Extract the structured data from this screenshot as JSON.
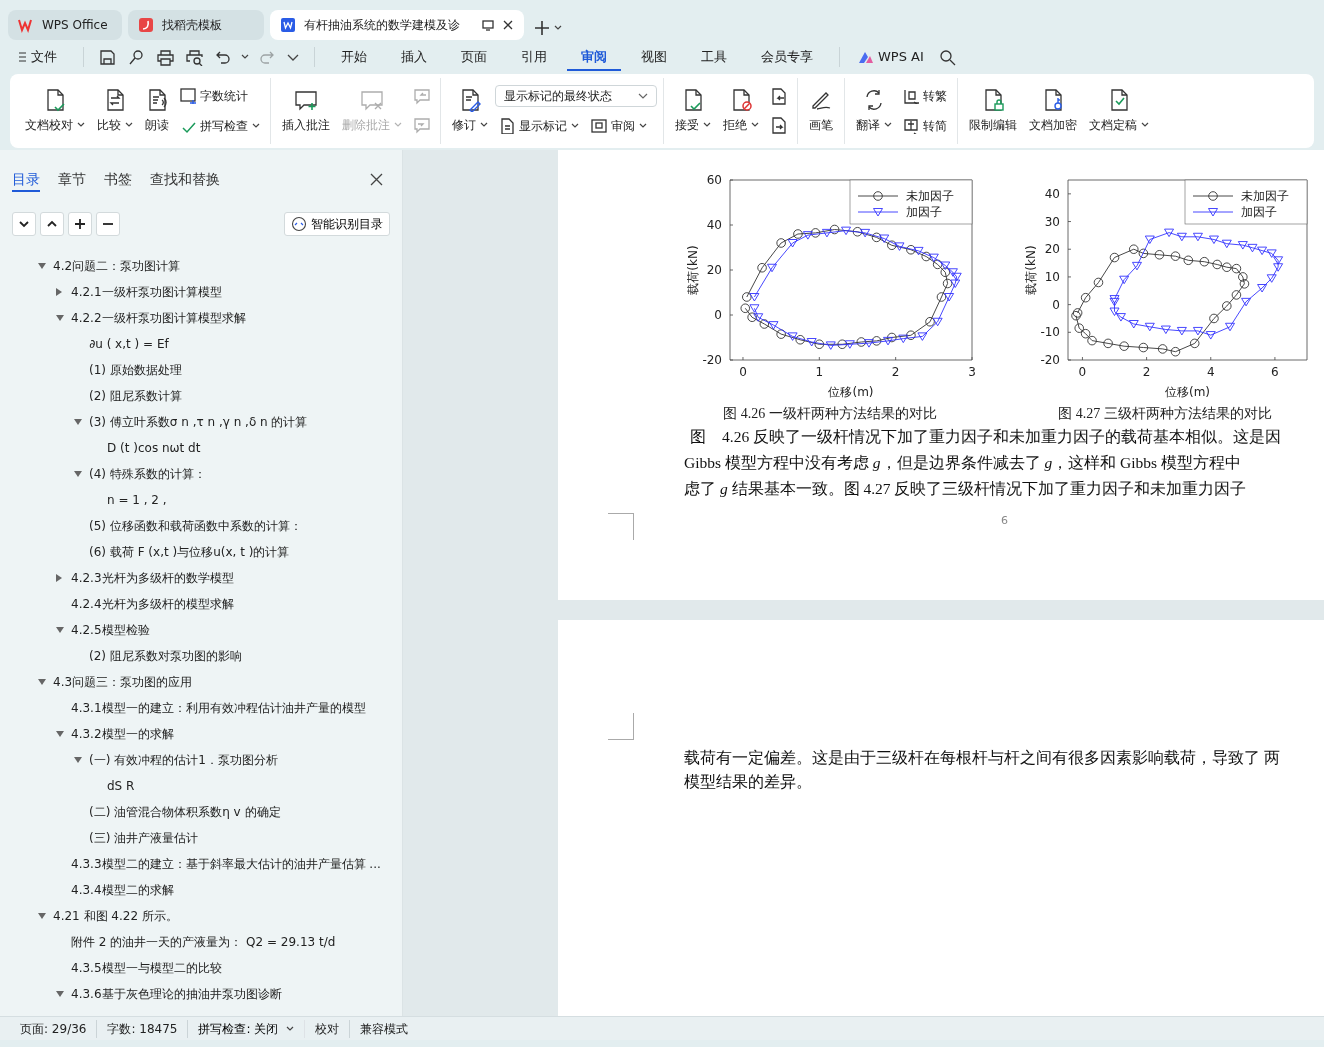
{
  "window_tabs": [
    {
      "label": "WPS Office",
      "selected": false
    },
    {
      "label": "找稻壳模板",
      "selected": false
    },
    {
      "label": "有杆抽油系统的数学建模及诊",
      "selected": true
    }
  ],
  "menu": {
    "file": "文件",
    "tabs": [
      {
        "label": "开始",
        "selected": false
      },
      {
        "label": "插入",
        "selected": false
      },
      {
        "label": "页面",
        "selected": false
      },
      {
        "label": "引用",
        "selected": false
      },
      {
        "label": "审阅",
        "selected": true
      },
      {
        "label": "视图",
        "selected": false
      },
      {
        "label": "工具",
        "selected": false
      },
      {
        "label": "会员专享",
        "selected": false
      }
    ],
    "ai": "WPS AI"
  },
  "ribbon": [
    {
      "items": [
        {
          "kind": "large",
          "label": "文档校对",
          "dropdown": true,
          "disabled": false
        },
        {
          "kind": "large",
          "label": "比较",
          "dropdown": true,
          "disabled": false
        },
        {
          "kind": "large",
          "label": "朗读",
          "dropdown": false,
          "disabled": false
        },
        {
          "kind": "stack",
          "rows": [
            [
              {
                "kind": "small",
                "label": "字数统计",
                "dropdown": false,
                "disabled": false
              }
            ],
            [
              {
                "kind": "small",
                "label": "拼写检查",
                "dropdown": true,
                "disabled": false
              }
            ]
          ]
        }
      ]
    },
    {
      "items": [
        {
          "kind": "large",
          "label": "插入批注",
          "dropdown": false,
          "disabled": false
        },
        {
          "kind": "large",
          "label": "删除批注",
          "dropdown": true,
          "disabled": true
        },
        {
          "kind": "stack",
          "rows": [
            [
              {
                "kind": "icon",
                "disabled": true
              }
            ],
            [
              {
                "kind": "icon",
                "disabled": true
              }
            ]
          ]
        }
      ]
    },
    {
      "items": [
        {
          "kind": "large",
          "label": "修订",
          "dropdown": true,
          "disabled": false
        },
        {
          "kind": "stack",
          "rows": [
            [
              {
                "kind": "select",
                "value": "显示标记的最终状态"
              }
            ],
            [
              {
                "kind": "small",
                "label": "显示标记",
                "dropdown": true,
                "disabled": false
              },
              {
                "kind": "small",
                "label": "审阅",
                "dropdown": true,
                "disabled": false
              }
            ]
          ]
        }
      ]
    },
    {
      "items": [
        {
          "kind": "large",
          "label": "接受",
          "dropdown": true,
          "disabled": false
        },
        {
          "kind": "large",
          "label": "拒绝",
          "dropdown": true,
          "disabled": false
        },
        {
          "kind": "stack",
          "rows": [
            [
              {
                "kind": "icon",
                "disabled": false
              }
            ],
            [
              {
                "kind": "icon",
                "disabled": false
              }
            ]
          ]
        }
      ]
    },
    {
      "items": [
        {
          "kind": "large",
          "label": "画笔",
          "dropdown": false,
          "disabled": false
        }
      ]
    },
    {
      "items": [
        {
          "kind": "large",
          "label": "翻译",
          "dropdown": true,
          "disabled": false
        },
        {
          "kind": "stack",
          "rows": [
            [
              {
                "kind": "small",
                "label": "转繁",
                "dropdown": false,
                "disabled": false
              }
            ],
            [
              {
                "kind": "small",
                "label": "转简",
                "dropdown": false,
                "disabled": false
              }
            ]
          ]
        }
      ]
    },
    {
      "items": [
        {
          "kind": "large",
          "label": "限制编辑",
          "dropdown": false,
          "disabled": false
        },
        {
          "kind": "large",
          "label": "文档加密",
          "dropdown": false,
          "disabled": false
        },
        {
          "kind": "large",
          "label": "文档定稿",
          "dropdown": true,
          "disabled": false
        }
      ]
    }
  ],
  "sidebar": {
    "tabs": [
      {
        "label": "目录",
        "selected": true
      },
      {
        "label": "章节",
        "selected": false
      },
      {
        "label": "书签",
        "selected": false
      },
      {
        "label": "查找和替换",
        "selected": false
      }
    ],
    "smart_button": "智能识别目录",
    "tree": [
      {
        "text": "4.2问题二：泵功图计算",
        "expanded": true,
        "children": [
          {
            "text": "4.2.1一级杆泵功图计算模型",
            "expanded": false
          },
          {
            "text": "4.2.2一级杆泵功图计算模型求解",
            "expanded": true,
            "children": [
              {
                "text": "∂u ( x,t ) = Ef"
              },
              {
                "text": "(1) 原始数据处理"
              },
              {
                "text": "(2) 阻尼系数计算"
              },
              {
                "text": "(3) 傅立叶系数σ n ,τ n ,γ n ,δ n 的计算",
                "expanded": true,
                "children": [
                  {
                    "text": "D (t )cos nωt dt"
                  }
                ]
              },
              {
                "text": "(4) 特殊系数的计算：",
                "expanded": true,
                "children": [
                  {
                    "text": "n = 1 , 2 ,"
                  }
                ]
              },
              {
                "text": "(5) 位移函数和载荷函数中系数的计算："
              },
              {
                "text": "(6) 载荷 F (x,t )与位移u(x, t )的计算"
              }
            ]
          },
          {
            "text": "4.2.3光杆为多级杆的数学模型",
            "expanded": false
          },
          {
            "text": "4.2.4光杆为多级杆的模型求解"
          },
          {
            "text": "4.2.5模型检验",
            "expanded": true,
            "children": [
              {
                "text": "(2) 阻尼系数对泵功图的影响"
              }
            ]
          }
        ]
      },
      {
        "text": "4.3问题三：泵功图的应用",
        "expanded": true,
        "children": [
          {
            "text": "4.3.1模型一的建立：利用有效冲程估计油井产量的模型"
          },
          {
            "text": "4.3.2模型一的求解",
            "expanded": true,
            "children": [
              {
                "text": "(一) 有效冲程的估计1．泵功图分析",
                "expanded": true,
                "children": [
                  {
                    "text": "dS  R"
                  }
                ]
              },
              {
                "text": "(二) 油管混合物体积系数η v 的确定"
              },
              {
                "text": "(三) 油井产液量估计"
              }
            ]
          },
          {
            "text": "4.3.3模型二的建立：基于斜率最大估计的油井产量估算 ..."
          },
          {
            "text": "4.3.4模型二的求解"
          }
        ]
      },
      {
        "text": "4.21 和图 4.22 所示。",
        "expanded": true,
        "children": [
          {
            "text": "附件 2 的油井一天的产液量为：  Q2 = 29.13 t/d"
          },
          {
            "text": "4.3.5模型一与模型二的比较"
          },
          {
            "text": "4.3.6基于灰色理论的抽油井泵功图诊断",
            "expanded": true
          }
        ]
      }
    ]
  },
  "document": {
    "figures": [
      {
        "caption": "图 4.26 一级杆两种方法结果的对比",
        "chart_data": {
          "type": "line",
          "legend": "upper right",
          "xlabel": "位移(m)",
          "ylabel": "载荷(kN)",
          "xlim": [
            -0.17,
            3
          ],
          "ylim": [
            -20,
            60
          ],
          "xticks": [
            0,
            1,
            2,
            3
          ],
          "yticks": [
            -20,
            0,
            20,
            40,
            60
          ],
          "series": [
            {
              "name": "未加因子",
              "color": "#333333",
              "marker": "circle",
              "x": [
                0.05,
                0.25,
                0.5,
                0.72,
                0.95,
                1.2,
                1.5,
                1.75,
                1.95,
                2.2,
                2.4,
                2.55,
                2.65,
                2.68,
                2.6,
                2.45,
                2.2,
                1.95,
                1.75,
                1.55,
                1.3,
                1.0,
                0.75,
                0.5,
                0.28,
                0.12,
                0.03
              ],
              "values": [
                8,
                21,
                32,
                36,
                36.5,
                38,
                37,
                34.5,
                31,
                29,
                26,
                22.5,
                19,
                14,
                8,
                -3,
                -9,
                -10,
                -11.5,
                -12,
                -13,
                -13,
                -11,
                -8.5,
                -4,
                -1,
                3
              ]
            },
            {
              "name": "加因子",
              "color": "#3333ff",
              "marker": "triangle",
              "x": [
                0.15,
                0.38,
                0.65,
                0.85,
                1.1,
                1.35,
                1.6,
                1.85,
                2.05,
                2.3,
                2.5,
                2.65,
                2.75,
                2.8,
                2.78,
                2.7,
                2.55,
                2.35,
                2.1,
                1.9,
                1.65,
                1.4,
                1.15,
                0.9,
                0.65,
                0.4,
                0.2,
                0.15
              ],
              "values": [
                8,
                21,
                32,
                35.5,
                36.5,
                37.5,
                36.5,
                34,
                30.5,
                28.5,
                25.5,
                22,
                19,
                17,
                14,
                8,
                -3,
                -9.5,
                -10.5,
                -11.5,
                -12.5,
                -13,
                -13.5,
                -12,
                -9.5,
                -4.5,
                -1,
                3
              ]
            }
          ]
        }
      },
      {
        "caption": "图 4.27 三级杆两种方法结果的对比",
        "chart_data": {
          "type": "line",
          "legend": "upper right",
          "xlabel": "位移(m)",
          "ylabel": "载荷(kN)",
          "xlim": [
            -0.45,
            7
          ],
          "ylim": [
            -20,
            45
          ],
          "xticks": [
            0,
            2,
            4,
            6
          ],
          "yticks": [
            -20,
            -10,
            0,
            10,
            20,
            30,
            40
          ],
          "series": [
            {
              "name": "未加因子",
              "color": "#333333",
              "marker": "circle",
              "x": [
                -0.15,
                0.1,
                0.5,
                1.0,
                1.6,
                1.9,
                2.4,
                2.9,
                3.3,
                3.8,
                4.2,
                4.5,
                4.8,
                5.0,
                5.05,
                4.8,
                4.5,
                4.1,
                3.5,
                2.9,
                2.5,
                1.9,
                1.3,
                0.8,
                0.3,
                0.1,
                -0.1,
                -0.2
              ],
              "values": [
                -3,
                2.5,
                8,
                17,
                20,
                18.5,
                18,
                17.5,
                16,
                15.5,
                14.5,
                13.5,
                13,
                10,
                7.5,
                3.5,
                -0.5,
                -5,
                -14,
                -17,
                -16,
                -15.5,
                -15,
                -14,
                -13,
                -10.5,
                -8.5,
                -4
              ]
            },
            {
              "name": "加因子",
              "color": "#3333ff",
              "marker": "triangle",
              "x": [
                1.0,
                1.3,
                1.7,
                2.1,
                2.7,
                3.1,
                3.6,
                4.1,
                4.5,
                5.0,
                5.3,
                5.6,
                5.9,
                6.1,
                6.1,
                5.9,
                5.6,
                5.1,
                4.6,
                4.0,
                3.6,
                3.1,
                2.6,
                2.1,
                1.6,
                1.2,
                1.0,
                1.0
              ],
              "values": [
                2,
                9,
                14,
                23.5,
                26,
                24.5,
                24.5,
                23.5,
                22,
                21.5,
                20.5,
                19.5,
                18.5,
                16,
                13.5,
                9.5,
                6,
                1,
                -8,
                -11,
                -9.5,
                -9.5,
                -9,
                -8,
                -7,
                -4.5,
                -2.5,
                1
              ]
            }
          ]
        }
      }
    ],
    "paragraph_lines": [
      "图　4.26 反映了一级杆情况下加了重力因子和未加重力因子的载荷基本相似。这是因",
      "Gibbs 模型方程中没有考虑 *g*，但是边界条件减去了 *g*，这样和 Gibbs 模型方程中",
      "虑了 *g* 结果基本一致。图 4.27 反映了三级杆情况下加了重力因子和未加重力因子"
    ],
    "page_number": "6",
    "next_page_lines": [
      "载荷有一定偏差。这是由于三级杆在每根杆与杆之间有很多因素影响载荷，导致了 两",
      "模型结果的差异。"
    ]
  },
  "status_bar": {
    "page": "页面: 29/36",
    "words": "字数: 18475",
    "spell": "拼写检查: 关闭",
    "proof": "校对",
    "mode": "兼容模式"
  }
}
